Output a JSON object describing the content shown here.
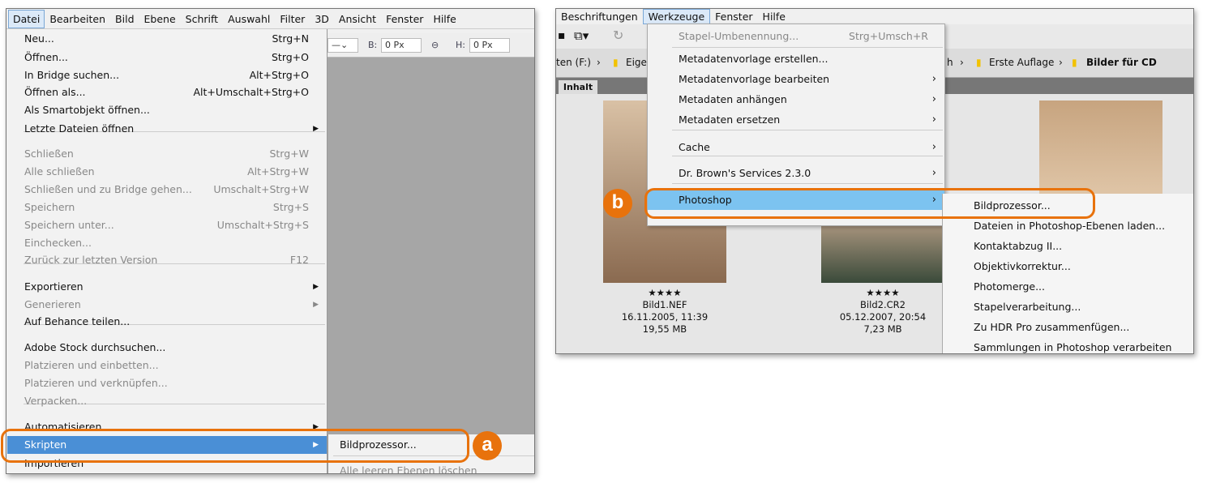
{
  "left": {
    "menubar": [
      "Datei",
      "Bearbeiten",
      "Bild",
      "Ebene",
      "Schrift",
      "Auswahl",
      "Filter",
      "3D",
      "Ansicht",
      "Fenster",
      "Hilfe"
    ],
    "toolbar": {
      "b_label": "B:",
      "b_value": "0 Px",
      "h_label": "H:",
      "h_value": "0 Px"
    },
    "menu": [
      {
        "label": "Neu...",
        "shortcut": "Strg+N"
      },
      {
        "label": "Öffnen...",
        "shortcut": "Strg+O"
      },
      {
        "label": "In Bridge suchen...",
        "shortcut": "Alt+Strg+O"
      },
      {
        "label": "Öffnen als...",
        "shortcut": "Alt+Umschalt+Strg+O"
      },
      {
        "label": "Als Smartobjekt öffnen...",
        "shortcut": ""
      },
      {
        "label": "Letzte Dateien öffnen",
        "shortcut": "",
        "submenu": true
      },
      {
        "label": "Schließen",
        "shortcut": "Strg+W",
        "disabled": true
      },
      {
        "label": "Alle schließen",
        "shortcut": "Alt+Strg+W",
        "disabled": true
      },
      {
        "label": "Schließen und zu Bridge gehen...",
        "shortcut": "Umschalt+Strg+W",
        "disabled": true
      },
      {
        "label": "Speichern",
        "shortcut": "Strg+S",
        "disabled": true
      },
      {
        "label": "Speichern unter...",
        "shortcut": "Umschalt+Strg+S",
        "disabled": true
      },
      {
        "label": "Einchecken...",
        "shortcut": "",
        "disabled": true
      },
      {
        "label": "Zurück zur letzten Version",
        "shortcut": "F12",
        "disabled": true
      },
      {
        "label": "Exportieren",
        "shortcut": "",
        "submenu": true
      },
      {
        "label": "Generieren",
        "shortcut": "",
        "submenu": true,
        "disabled": true
      },
      {
        "label": "Auf Behance teilen...",
        "shortcut": ""
      },
      {
        "label": "Adobe Stock durchsuchen...",
        "shortcut": ""
      },
      {
        "label": "Platzieren und einbetten...",
        "shortcut": "",
        "disabled": true
      },
      {
        "label": "Platzieren und verknüpfen...",
        "shortcut": "",
        "disabled": true
      },
      {
        "label": "Verpacken...",
        "shortcut": "",
        "disabled": true
      },
      {
        "label": "Automatisieren",
        "shortcut": "",
        "submenu": true
      },
      {
        "label": "Skripten",
        "shortcut": "",
        "submenu": true,
        "selected": true
      },
      {
        "label": "Importieren",
        "shortcut": ""
      }
    ],
    "submenu": [
      "Bildprozessor...",
      "Alle leeren Ebenen löschen"
    ],
    "badge": "a"
  },
  "right": {
    "menubar": [
      "Beschriftungen",
      "Werkzeuge",
      "Fenster",
      "Hilfe"
    ],
    "path": [
      "ten (F:)",
      "Eige",
      "h",
      "Erste Auflage",
      "Bilder für CD"
    ],
    "tab": "Inhalt",
    "menu": [
      {
        "label": "Stapel-Umbenennung...",
        "shortcut": "Strg+Umsch+R",
        "disabled": true
      },
      {
        "label": "Metadatenvorlage erstellen..."
      },
      {
        "label": "Metadatenvorlage bearbeiten",
        "submenu": true
      },
      {
        "label": "Metadaten anhängen",
        "submenu": true
      },
      {
        "label": "Metadaten ersetzen",
        "submenu": true
      },
      {
        "label": "Cache",
        "submenu": true
      },
      {
        "label": "Dr. Brown's Services 2.3.0",
        "submenu": true
      },
      {
        "label": "Photoshop",
        "submenu": true,
        "selected": true
      }
    ],
    "submenu": [
      "Bildprozessor...",
      "Dateien in Photoshop-Ebenen laden...",
      "Kontaktabzug II...",
      "Objektivkorrektur...",
      "Photomerge...",
      "Stapelverarbeitung...",
      "Zu HDR Pro zusammenfügen...",
      "Sammlungen in Photoshop verarbeiten"
    ],
    "thumbs": [
      {
        "rating": "★★★★",
        "name": "Bild1.NEF",
        "date": "16.11.2005, 11:39",
        "size": "19,55 MB"
      },
      {
        "rating": "★★★★",
        "name": "Bild2.CR2",
        "date": "05.12.2007, 20:54",
        "size": "7,23 MB"
      }
    ],
    "badge": "b"
  },
  "colors": {
    "accent": "#e8720c",
    "selection_left": "#4a8fd6",
    "selection_right": "#7cc3f0"
  }
}
